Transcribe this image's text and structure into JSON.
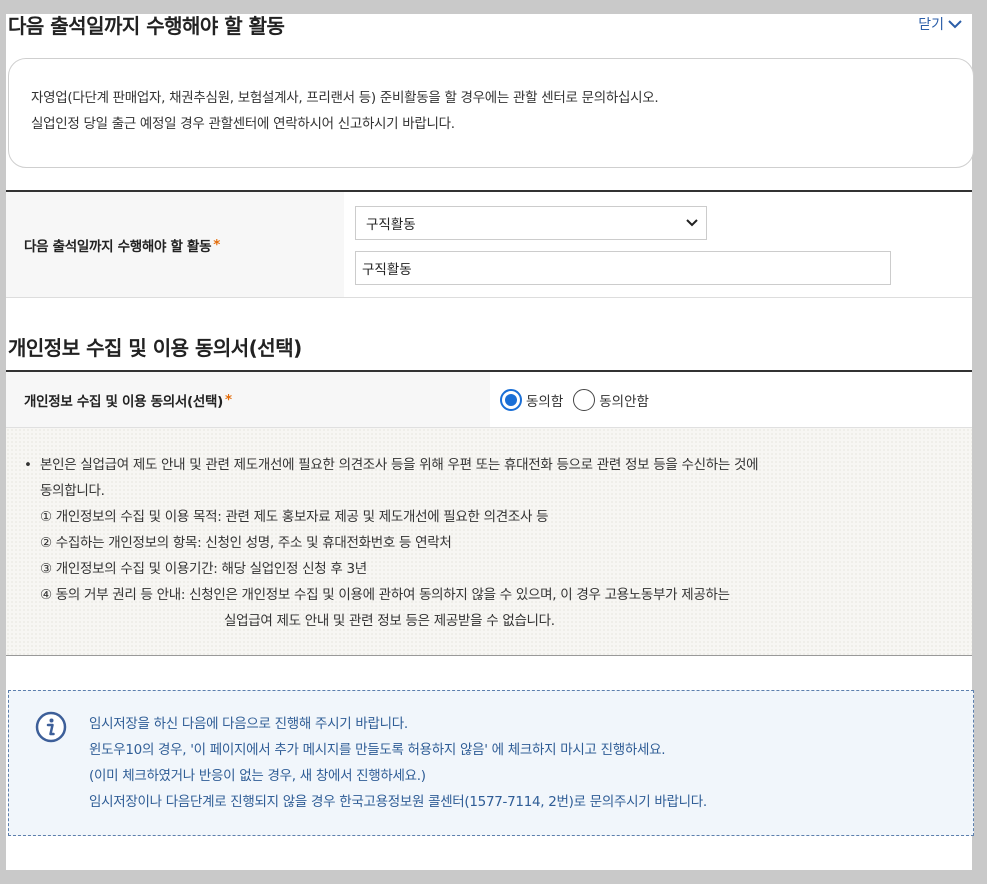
{
  "section1": {
    "title": "다음 출석일까지 수행해야 할 활동",
    "close_label": "닫기",
    "notice_lines": [
      "자영업(다단계 판매업자, 채권추심원, 보험설계사, 프리랜서 등) 준비활동을 할 경우에는 관할 센터로 문의하십시오.",
      "실업인정 당일 출근 예정일 경우 관할센터에 연락하시어 신고하시기 바랍니다."
    ],
    "form": {
      "label": "다음 출석일까지 수행해야 할 활동",
      "required_mark": "*",
      "select_value": "구직활동",
      "input_value": "구직활동"
    }
  },
  "section2": {
    "title": "개인정보 수집 및 이용 동의서(선택)",
    "row_label": "개인정보 수집 및 이용 동의서(선택)",
    "required_mark": "*",
    "radio_agree": "동의함",
    "radio_disagree": "동의안함",
    "selected": "agree",
    "body": {
      "bullet": "•",
      "line1": "본인은 실업급여 제도 안내 및 관련 제도개선에 필요한 의견조사 등을 위해 우편 또는 휴대전화 등으로 관련 정보 등을 수신하는 것에",
      "line2": "동의합니다.",
      "item1": "① 개인정보의 수집 및 이용 목적: 관련 제도 홍보자료 제공 및 제도개선에 필요한 의견조사 등",
      "item2": "② 수집하는 개인정보의 항목: 신청인 성명, 주소 및 휴대전화번호 등 연락처",
      "item3": "③ 개인정보의 수집 및 이용기간: 해당 실업인정 신청 후 3년",
      "item4": "④ 동의 거부 권리 등 안내: 신청인은 개인정보 수집 및 이용에 관하여 동의하지 않을 수 있으며, 이 경우 고용노동부가 제공하는",
      "item4_cont": "실업급여 제도 안내 및 관련 정보 등은 제공받을 수 없습니다."
    }
  },
  "info": {
    "icon": "info-icon",
    "lines": [
      "임시저장을 하신 다음에 다음으로 진행해 주시기 바랍니다.",
      "윈도우10의 경우, '이 페이지에서 추가 메시지를 만들도록 허용하지 않음' 에 체크하지 마시고 진행하세요.",
      "(이미 체크하였거나 반응이 없는 경우, 새 창에서 진행하세요.)",
      "임시저장이나 다음단계로 진행되지 않을 경우 한국고용정보원 콜센터(1577-7114, 2번)로 문의주시기 바랍니다."
    ]
  },
  "colors": {
    "accent_blue": "#1a6fd6",
    "link_blue": "#2b5ea8",
    "required_orange": "#e36c0a",
    "info_text": "#2f5d96"
  }
}
